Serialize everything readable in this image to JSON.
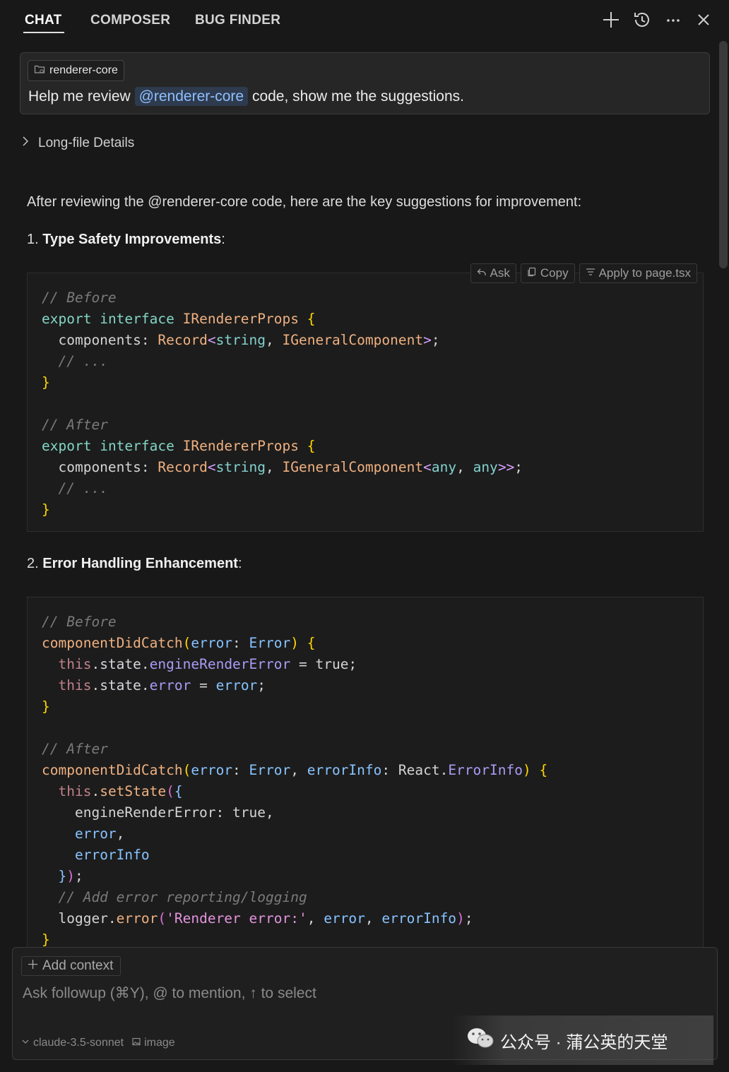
{
  "tabs": [
    {
      "label": "CHAT",
      "active": true
    },
    {
      "label": "COMPOSER",
      "active": false
    },
    {
      "label": "BUG FINDER",
      "active": false
    }
  ],
  "toolbar_icons": [
    "plus-icon",
    "history-icon",
    "more-icon",
    "close-icon"
  ],
  "query": {
    "context_chip": "renderer-core",
    "text_before": "Help me review",
    "mention": "@renderer-core",
    "text_after": "code, show me the suggestions."
  },
  "details_label": "Long-file Details",
  "response": {
    "intro": "After reviewing the @renderer-core code, here are the key suggestions for improvement:",
    "section1_num": "1.",
    "section1_title": "Type Safety Improvements",
    "section1_suffix": ":",
    "section2_num": "2.",
    "section2_title": "Error Handling Enhancement",
    "section2_suffix": ":"
  },
  "code_actions": {
    "ask": "Ask",
    "copy": "Copy",
    "apply": "Apply to page.tsx"
  },
  "composer": {
    "add_context": "Add context",
    "placeholder": "Ask followup (⌘Y), @ to mention, ↑ to select",
    "model": "claude-3.5-sonnet",
    "image_label": "image"
  },
  "watermark": {
    "text": "公众号 · 蒲公英的天堂"
  },
  "colors": {
    "background": "#181818",
    "mention_bg": "#2e3b4e",
    "mention_fg": "#8fbfff"
  }
}
